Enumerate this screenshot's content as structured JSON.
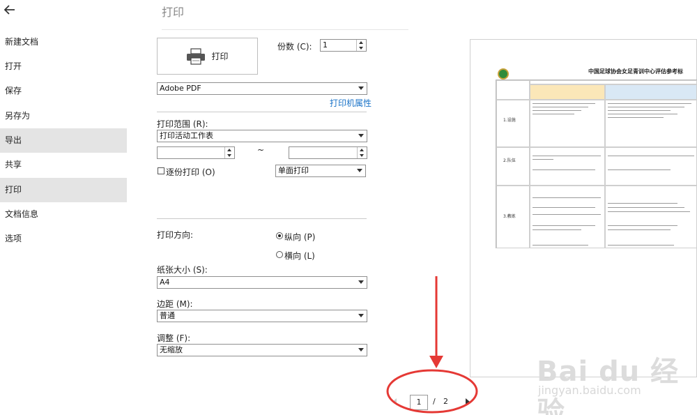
{
  "sidebar": {
    "items": [
      {
        "label": "新建文档"
      },
      {
        "label": "打开"
      },
      {
        "label": "保存"
      },
      {
        "label": "另存为"
      },
      {
        "label": "导出"
      },
      {
        "label": "共享"
      },
      {
        "label": "打印"
      },
      {
        "label": "文档信息"
      },
      {
        "label": "选项"
      }
    ],
    "back_icon": "arrow-left-icon"
  },
  "page_title": "打印",
  "print_button": {
    "label": "打印",
    "icon": "printer-icon"
  },
  "copies": {
    "label": "份数 (C):",
    "value": "1"
  },
  "printer": {
    "selected": "Adobe PDF",
    "properties_link": "打印机属性"
  },
  "print_range": {
    "label": "打印范围 (R):",
    "selected": "打印活动工作表",
    "from": "",
    "to": "",
    "separator": "~"
  },
  "collate": {
    "label": "逐份打印 (O)",
    "checked": false
  },
  "sides": {
    "selected": "单面打印"
  },
  "orientation": {
    "label": "打印方向:",
    "portrait": "纵向 (P)",
    "landscape": "横向 (L)",
    "selected": "portrait"
  },
  "paper_size": {
    "label": "纸张大小 (S):",
    "selected": "A4"
  },
  "margins": {
    "label": "边距 (M):",
    "selected": "普通"
  },
  "scaling": {
    "label": "调整 (F):",
    "selected": "无缩放"
  },
  "preview": {
    "doc_title": "中国足球协会女足青训中心评估参考标",
    "row_labels": [
      "1.设施",
      "2.队伍",
      "3.教练"
    ]
  },
  "pager": {
    "current": "1",
    "separator": "/",
    "total": "2"
  },
  "watermark": {
    "brand": "Bai du 经验",
    "url": "jingyan.baidu.com"
  },
  "colors": {
    "accent": "#1a73c8",
    "annotation": "#e53935",
    "sidebar_active": "#e4e4e4"
  }
}
